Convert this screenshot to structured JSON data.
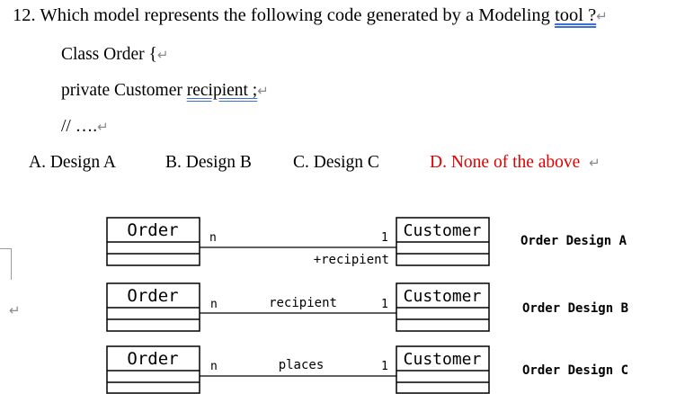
{
  "question": {
    "text_main": "12. Which model represents the following code generated by a Modeling ",
    "text_link": "tool ?",
    "mark": "↵"
  },
  "code": {
    "line1": "Class Order {",
    "line2_prefix": "private Customer ",
    "line2_link": "recipient ;",
    "line3": "// ….",
    "mark": "↵"
  },
  "options": {
    "a": "A. Design A",
    "b": "B. Design B",
    "c": "C. Design C",
    "d": "D. None of the above",
    "d_color": "#e00000",
    "mark": "↵"
  },
  "diagrams": [
    {
      "left_class": "Order",
      "right_class": "Customer",
      "left_mult": "n",
      "right_mult": "1",
      "assoc_label": "+recipient",
      "caption": "Order Design A"
    },
    {
      "left_class": "Order",
      "right_class": "Customer",
      "left_mult": "n",
      "right_mult": "1",
      "assoc_label": "recipient",
      "caption": "Order Design B"
    },
    {
      "left_class": "Order",
      "right_class": "Customer",
      "left_mult": "n",
      "right_mult": "1",
      "assoc_label": "places",
      "caption": "Order Design C"
    }
  ],
  "margin_mark": "↵"
}
